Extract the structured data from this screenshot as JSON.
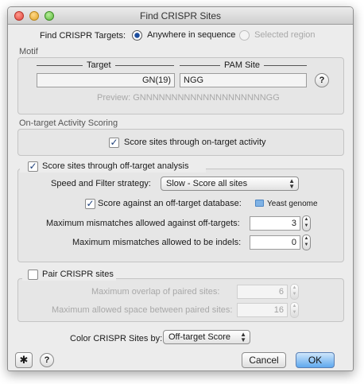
{
  "window": {
    "title": "Find CRISPR Sites"
  },
  "targets": {
    "label": "Find CRISPR Targets:",
    "options": [
      "Anywhere in sequence",
      "Selected region"
    ],
    "selected": "Anywhere in sequence"
  },
  "motif": {
    "group_label": "Motif",
    "target_header": "Target",
    "pam_header": "PAM Site",
    "target_value": "GN(19)",
    "pam_value": "NGG",
    "preview_label": "Preview:",
    "preview_value": "GNNNNNNNNNNNNNNNNNNNNGG",
    "help": "?"
  },
  "on_target": {
    "group_label": "On-target Activity Scoring",
    "checkbox_label": "Score sites through on-target activity",
    "checked": true
  },
  "off_target": {
    "checkbox_label": "Score sites through off-target analysis",
    "checked": true,
    "strategy_label": "Speed and Filter strategy:",
    "strategy_value": "Slow - Score all sites",
    "database_label": "Score against an off-target database:",
    "database_checked": true,
    "database_value": "Yeast genome",
    "mismatch_label": "Maximum mismatches allowed against off-targets:",
    "mismatch_value": "3",
    "indel_label": "Maximum mismatches allowed to be indels:",
    "indel_value": "0"
  },
  "pair": {
    "checkbox_label": "Pair CRISPR sites",
    "checked": false,
    "overlap_label": "Maximum overlap of paired sites:",
    "overlap_value": "6",
    "space_label": "Maximum allowed space between paired sites:",
    "space_value": "16"
  },
  "color": {
    "label": "Color CRISPR Sites by:",
    "value": "Off-target Score"
  },
  "footer": {
    "help": "?",
    "cancel": "Cancel",
    "ok": "OK"
  },
  "icons": {
    "check": "check-icon",
    "gear": "gear-icon",
    "folder": "folder-icon"
  },
  "colors": {
    "accent": "#5ea8ee",
    "check": "#1d3f7a"
  }
}
